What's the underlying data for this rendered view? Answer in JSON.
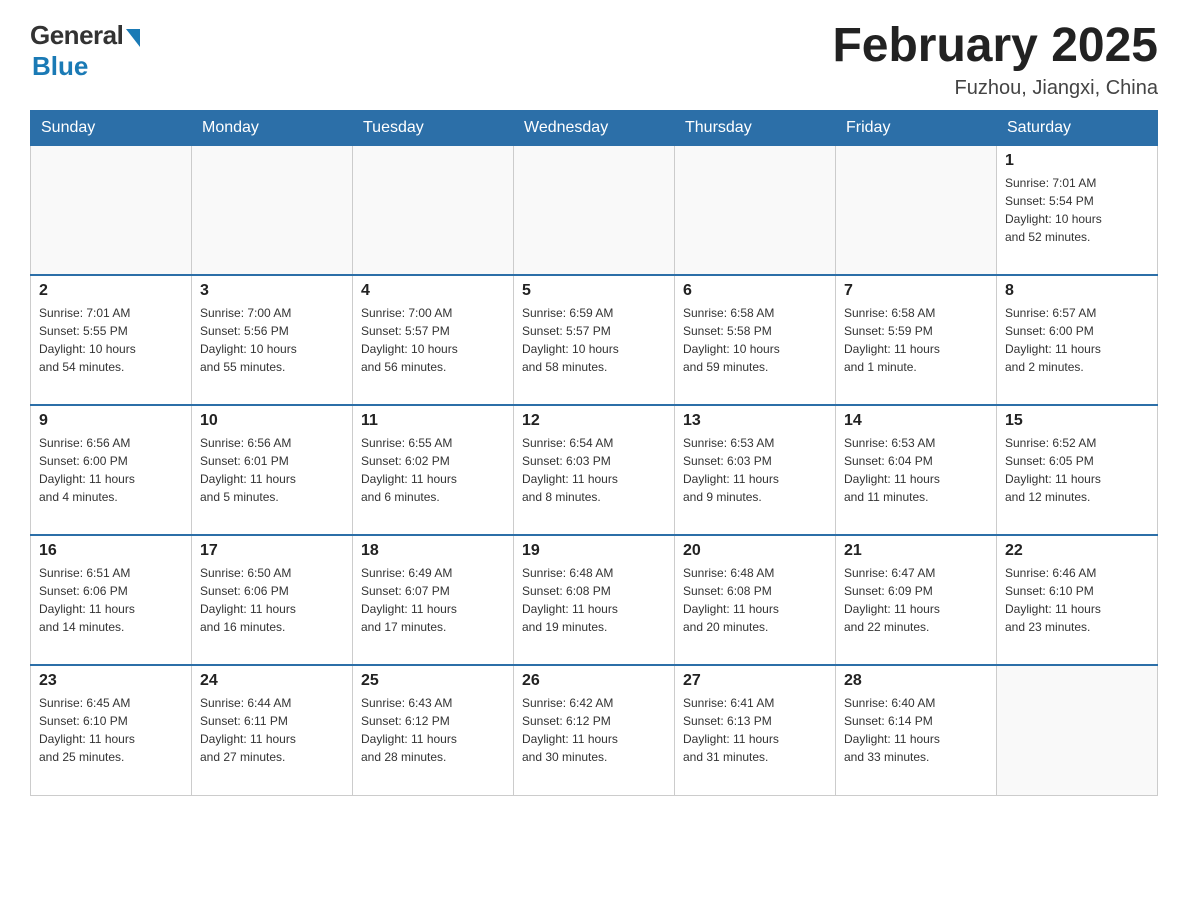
{
  "header": {
    "logo_general": "General",
    "logo_blue": "Blue",
    "month_title": "February 2025",
    "location": "Fuzhou, Jiangxi, China"
  },
  "weekdays": [
    "Sunday",
    "Monday",
    "Tuesday",
    "Wednesday",
    "Thursday",
    "Friday",
    "Saturday"
  ],
  "weeks": [
    [
      {
        "day": "",
        "info": ""
      },
      {
        "day": "",
        "info": ""
      },
      {
        "day": "",
        "info": ""
      },
      {
        "day": "",
        "info": ""
      },
      {
        "day": "",
        "info": ""
      },
      {
        "day": "",
        "info": ""
      },
      {
        "day": "1",
        "info": "Sunrise: 7:01 AM\nSunset: 5:54 PM\nDaylight: 10 hours\nand 52 minutes."
      }
    ],
    [
      {
        "day": "2",
        "info": "Sunrise: 7:01 AM\nSunset: 5:55 PM\nDaylight: 10 hours\nand 54 minutes."
      },
      {
        "day": "3",
        "info": "Sunrise: 7:00 AM\nSunset: 5:56 PM\nDaylight: 10 hours\nand 55 minutes."
      },
      {
        "day": "4",
        "info": "Sunrise: 7:00 AM\nSunset: 5:57 PM\nDaylight: 10 hours\nand 56 minutes."
      },
      {
        "day": "5",
        "info": "Sunrise: 6:59 AM\nSunset: 5:57 PM\nDaylight: 10 hours\nand 58 minutes."
      },
      {
        "day": "6",
        "info": "Sunrise: 6:58 AM\nSunset: 5:58 PM\nDaylight: 10 hours\nand 59 minutes."
      },
      {
        "day": "7",
        "info": "Sunrise: 6:58 AM\nSunset: 5:59 PM\nDaylight: 11 hours\nand 1 minute."
      },
      {
        "day": "8",
        "info": "Sunrise: 6:57 AM\nSunset: 6:00 PM\nDaylight: 11 hours\nand 2 minutes."
      }
    ],
    [
      {
        "day": "9",
        "info": "Sunrise: 6:56 AM\nSunset: 6:00 PM\nDaylight: 11 hours\nand 4 minutes."
      },
      {
        "day": "10",
        "info": "Sunrise: 6:56 AM\nSunset: 6:01 PM\nDaylight: 11 hours\nand 5 minutes."
      },
      {
        "day": "11",
        "info": "Sunrise: 6:55 AM\nSunset: 6:02 PM\nDaylight: 11 hours\nand 6 minutes."
      },
      {
        "day": "12",
        "info": "Sunrise: 6:54 AM\nSunset: 6:03 PM\nDaylight: 11 hours\nand 8 minutes."
      },
      {
        "day": "13",
        "info": "Sunrise: 6:53 AM\nSunset: 6:03 PM\nDaylight: 11 hours\nand 9 minutes."
      },
      {
        "day": "14",
        "info": "Sunrise: 6:53 AM\nSunset: 6:04 PM\nDaylight: 11 hours\nand 11 minutes."
      },
      {
        "day": "15",
        "info": "Sunrise: 6:52 AM\nSunset: 6:05 PM\nDaylight: 11 hours\nand 12 minutes."
      }
    ],
    [
      {
        "day": "16",
        "info": "Sunrise: 6:51 AM\nSunset: 6:06 PM\nDaylight: 11 hours\nand 14 minutes."
      },
      {
        "day": "17",
        "info": "Sunrise: 6:50 AM\nSunset: 6:06 PM\nDaylight: 11 hours\nand 16 minutes."
      },
      {
        "day": "18",
        "info": "Sunrise: 6:49 AM\nSunset: 6:07 PM\nDaylight: 11 hours\nand 17 minutes."
      },
      {
        "day": "19",
        "info": "Sunrise: 6:48 AM\nSunset: 6:08 PM\nDaylight: 11 hours\nand 19 minutes."
      },
      {
        "day": "20",
        "info": "Sunrise: 6:48 AM\nSunset: 6:08 PM\nDaylight: 11 hours\nand 20 minutes."
      },
      {
        "day": "21",
        "info": "Sunrise: 6:47 AM\nSunset: 6:09 PM\nDaylight: 11 hours\nand 22 minutes."
      },
      {
        "day": "22",
        "info": "Sunrise: 6:46 AM\nSunset: 6:10 PM\nDaylight: 11 hours\nand 23 minutes."
      }
    ],
    [
      {
        "day": "23",
        "info": "Sunrise: 6:45 AM\nSunset: 6:10 PM\nDaylight: 11 hours\nand 25 minutes."
      },
      {
        "day": "24",
        "info": "Sunrise: 6:44 AM\nSunset: 6:11 PM\nDaylight: 11 hours\nand 27 minutes."
      },
      {
        "day": "25",
        "info": "Sunrise: 6:43 AM\nSunset: 6:12 PM\nDaylight: 11 hours\nand 28 minutes."
      },
      {
        "day": "26",
        "info": "Sunrise: 6:42 AM\nSunset: 6:12 PM\nDaylight: 11 hours\nand 30 minutes."
      },
      {
        "day": "27",
        "info": "Sunrise: 6:41 AM\nSunset: 6:13 PM\nDaylight: 11 hours\nand 31 minutes."
      },
      {
        "day": "28",
        "info": "Sunrise: 6:40 AM\nSunset: 6:14 PM\nDaylight: 11 hours\nand 33 minutes."
      },
      {
        "day": "",
        "info": ""
      }
    ]
  ]
}
